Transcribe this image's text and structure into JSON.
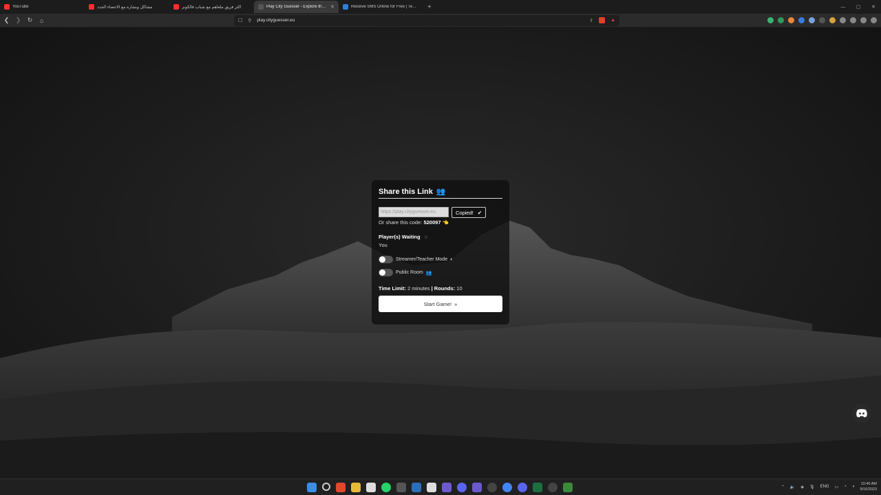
{
  "browser": {
    "tabs": [
      {
        "label": "YouTube",
        "fav_color": "#ff2d2d",
        "active": false
      },
      {
        "label": "مشاكل وبشارة مع الاعضاء الجدد",
        "fav_color": "#ff2d2d",
        "active": false
      },
      {
        "label": "اكثر فريق ملعاهم مع شباب فالكونز",
        "fav_color": "#ff2d2d",
        "active": false
      },
      {
        "label": "Play City Guesser - Explore the W",
        "fav_color": "#3a3a3a",
        "active": true
      },
      {
        "label": "Receive SMS Online for Free | Tempo",
        "fav_color": "#2f7de1",
        "active": false
      }
    ],
    "new_tab": "+",
    "url": "play.cityguesser.eu"
  },
  "card": {
    "title": "Share this Link",
    "link_value": "https://play.cityguesser.eu",
    "copied_label": "Copied!",
    "share_prefix": "Or share this code:",
    "share_code": "520097",
    "waiting_label": "Player(s) Waiting",
    "players": [
      "You"
    ],
    "streamer_label": "Streamer/Teacher Mode",
    "public_label": "Public Room",
    "time_limit_label": "Time Limit:",
    "time_limit_value": "2 minutes",
    "rounds_label": "| Rounds:",
    "rounds_value": "10",
    "start_label": "Start Game!",
    "streamer_on": false,
    "public_on": false
  },
  "taskbar": {
    "lang": "ENG",
    "time": "10:40 AM",
    "date": "9/16/2023"
  }
}
